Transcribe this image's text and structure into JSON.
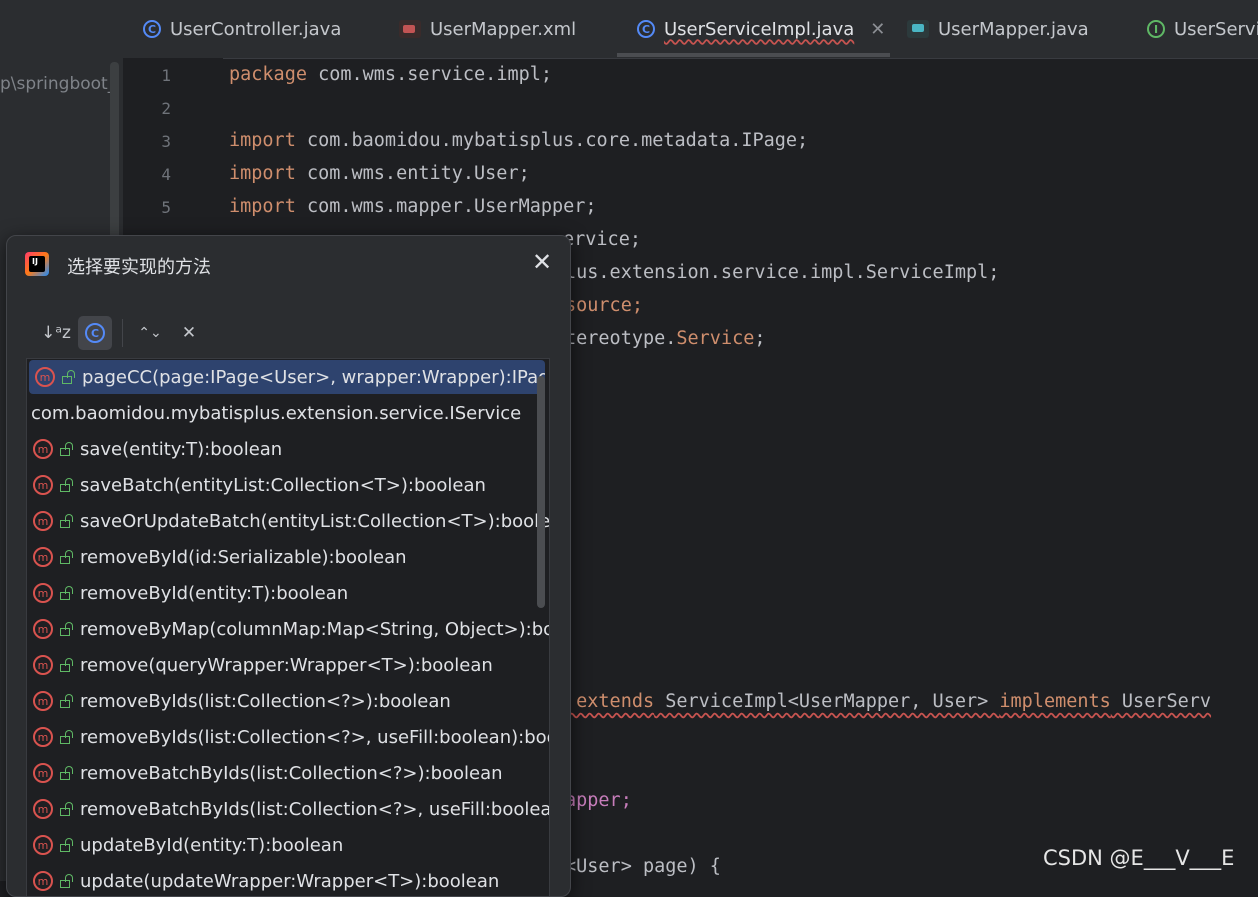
{
  "tabs": [
    {
      "label": "UserController.java",
      "icon": "class-icon"
    },
    {
      "label": "UserMapper.xml",
      "icon": "mybatis-xml-icon"
    },
    {
      "label": "UserServiceImpl.java",
      "icon": "class-icon",
      "active": true
    },
    {
      "label": "UserMapper.java",
      "icon": "mybatis-mapper-icon"
    },
    {
      "label": "UserServic",
      "icon": "interface-icon"
    }
  ],
  "project_path": "p\\springboot_",
  "line_numbers": [
    "1",
    "2",
    "3",
    "4",
    "5"
  ],
  "code": {
    "l1_kw": "package",
    "l1": " com.wms.service.impl;",
    "l3_kw": "import",
    "l3": " com.baomidou.mybatisplus.core.metadata.IPage;",
    "l4_kw": "import",
    "l4": " com.wms.entity.User;",
    "l5_kw": "import",
    "l5": " com.wms.mapper.UserMapper;",
    "l6": "ervice;",
    "l7": "lus.extension.service.impl.ServiceImpl;",
    "l8": "source;",
    "l9_a": "tereotype.",
    "l9_b": "Service",
    "l9_c": ";",
    "l10_a": " extends",
    "l10_b": " ServiceImpl<UserMapper, User> ",
    "l10_c": "implements",
    "l10_d": " UserServ",
    "l11": "apper;",
    "l12": "<User> page) {"
  },
  "dialog": {
    "title": "选择要实现的方法",
    "close_glyph": "✕",
    "sort_glyph": "↓ᵃz",
    "expand_glyph": "⌃⌄",
    "collapse_glyph": "✕",
    "class_glyph": "C",
    "method_glyph": "m",
    "items": [
      {
        "text": "pageCC(page:IPage<User>, wrapper:Wrapper):IPage",
        "selected": true
      },
      {
        "text": "com.baomidou.mybatisplus.extension.service.IService",
        "group": true
      },
      {
        "text": "save(entity:T):boolean"
      },
      {
        "text": "saveBatch(entityList:Collection<T>):boolean"
      },
      {
        "text": "saveOrUpdateBatch(entityList:Collection<T>):boolean"
      },
      {
        "text": "removeById(id:Serializable):boolean"
      },
      {
        "text": "removeById(entity:T):boolean"
      },
      {
        "text": "removeByMap(columnMap:Map<String, Object>):boo"
      },
      {
        "text": "remove(queryWrapper:Wrapper<T>):boolean"
      },
      {
        "text": "removeByIds(list:Collection<?>):boolean"
      },
      {
        "text": "removeByIds(list:Collection<?>, useFill:boolean):boolea"
      },
      {
        "text": "removeBatchByIds(list:Collection<?>):boolean"
      },
      {
        "text": "removeBatchByIds(list:Collection<?>, useFill:boolean):b"
      },
      {
        "text": "updateById(entity:T):boolean"
      },
      {
        "text": "update(updateWrapper:Wrapper<T>):boolean"
      }
    ]
  },
  "watermark": "CSDN @E___V___E",
  "colors": {
    "accent": "#548af7",
    "method": "#d9534f",
    "keyword": "#cf8e6d",
    "selection": "#2e436e"
  }
}
